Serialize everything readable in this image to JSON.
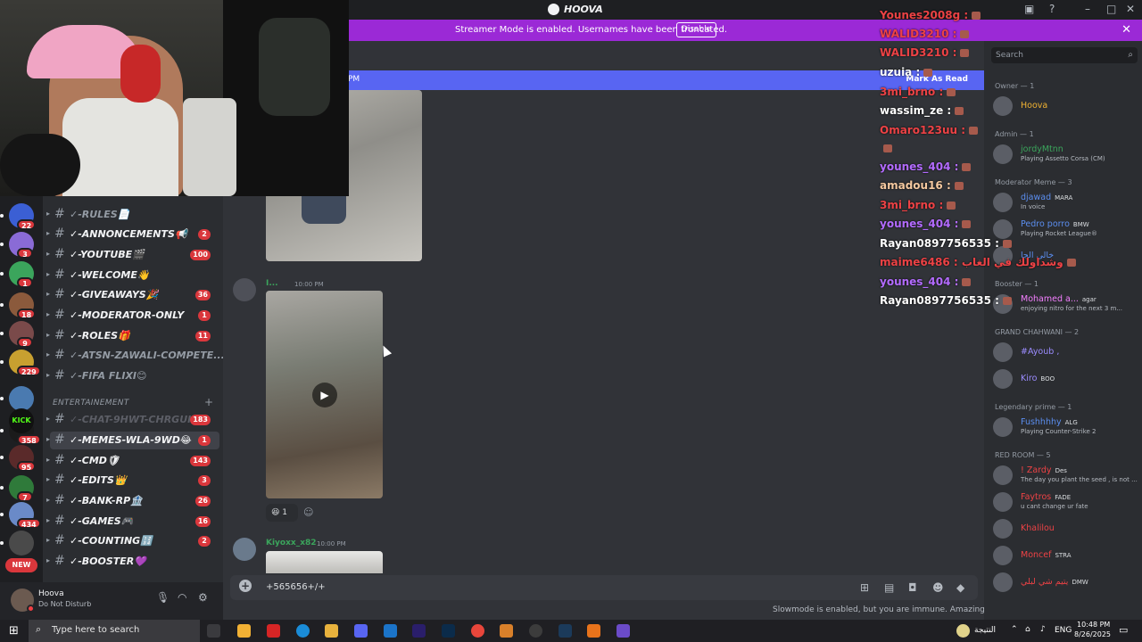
{
  "titlebar": {
    "brand": "HOOVA"
  },
  "banner": {
    "text": "Streamer Mode is enabled. Usernames have been truncated.",
    "button": "Disable"
  },
  "rail": {
    "badges": [
      "22",
      "3",
      "1",
      "18",
      "9",
      "229",
      "358",
      "95",
      "7",
      "434"
    ],
    "new_label": "NEW",
    "kick_label": "KICK"
  },
  "channels": {
    "items": [
      {
        "name": "✓-RULES📄",
        "count": "",
        "state": "dim"
      },
      {
        "name": "✓-ANNONCEMENTS📢",
        "count": "2",
        "state": "normal"
      },
      {
        "name": "✓-YOUTUBE🎬",
        "count": "100",
        "state": "normal"
      },
      {
        "name": "✓-WELCOME👋",
        "count": "",
        "state": "normal"
      },
      {
        "name": "✓-GIVEAWAYS🎉",
        "count": "36",
        "state": "normal"
      },
      {
        "name": "✓-MODERATOR-ONLY",
        "count": "1",
        "state": "normal"
      },
      {
        "name": "✓-ROLES🎁",
        "count": "11",
        "state": "normal"
      },
      {
        "name": "✓-ATSN-ZAWALI-COMPETE...",
        "count": "",
        "state": "dim"
      },
      {
        "name": "✓-FIFA FLIXI😊",
        "count": "",
        "state": "dim"
      }
    ],
    "category": "ENTERTAINEMENT",
    "items2": [
      {
        "name": "✓-CHAT-9HWT-CHRGUI",
        "count": "183",
        "state": "muted"
      },
      {
        "name": "✓-MEMES-WLA-9WD😂",
        "count": "1",
        "state": "active"
      },
      {
        "name": "✓-CMD🛡",
        "count": "143",
        "state": "normal"
      },
      {
        "name": "✓-EDITS👑",
        "count": "3",
        "state": "normal"
      },
      {
        "name": "✓-BANK-RP🏦",
        "count": "26",
        "state": "normal"
      },
      {
        "name": "✓-GAMES🎮",
        "count": "16",
        "state": "normal"
      },
      {
        "name": "✓-COUNTING🔢",
        "count": "2",
        "state": "normal"
      },
      {
        "name": "✓-BOOSTER💜",
        "count": "",
        "state": "normal"
      }
    ]
  },
  "user": {
    "name": "Hoova",
    "status": "Do Not Disturb"
  },
  "chat": {
    "mark_read_left": "PM",
    "mark_read": "Mark As Read",
    "msg1_name": "I...",
    "msg1_time": "10:00 PM",
    "reaction_count": "1",
    "msg2_name": "Kiyoxx_x82",
    "msg2_time": "10:00 PM"
  },
  "composer": {
    "text": "+565656+/+",
    "slowmode": "Slowmode is enabled, but you are immune. Amazing!"
  },
  "members": {
    "search_placeholder": "Search",
    "groups": [
      {
        "title": "Owner — 1",
        "list": [
          {
            "name": "Hoova",
            "sub": "",
            "tag": "",
            "color": "#f0b232"
          }
        ]
      },
      {
        "title": "Admin — 1",
        "list": [
          {
            "name": "jordyMtnn",
            "sub": "Playing Assetto Corsa (CM)",
            "tag": "",
            "color": "#3ba55c"
          }
        ]
      },
      {
        "title": "Moderator Meme — 3",
        "list": [
          {
            "name": "djawad",
            "sub": "In voice",
            "tag": "MARA",
            "color": "#5b8ef0"
          },
          {
            "name": "Pedro porro",
            "sub": "Playing Rocket League®",
            "tag": "BMW",
            "color": "#5b8ef0"
          },
          {
            "name": "خالي الجا",
            "sub": "",
            "tag": "",
            "color": "#5b8ef0"
          }
        ]
      },
      {
        "title": "Booster — 1",
        "list": [
          {
            "name": "Mohamed a...",
            "sub": "enjoying nitro for the next 3 m...",
            "tag": "agar",
            "color": "#f47fff"
          }
        ]
      },
      {
        "title": "GRAND CHAHWANI — 2",
        "list": [
          {
            "name": "#Ayoub ,",
            "sub": "",
            "tag": "",
            "color": "#9b8cff"
          },
          {
            "name": "Kiro",
            "sub": "",
            "tag": "BOO",
            "color": "#9b8cff"
          }
        ]
      },
      {
        "title": "Legendary prime — 1",
        "list": [
          {
            "name": "Fushhhhy",
            "sub": "Playing Counter-Strike 2",
            "tag": "ALG",
            "color": "#5b8ef0"
          }
        ]
      },
      {
        "title": "RED ROOM — 5",
        "list": [
          {
            "name": "! Zardy",
            "sub": "The day you plant the seed , is not ...",
            "tag": "Des",
            "color": "#ed4245"
          },
          {
            "name": "Faytros",
            "sub": "u cant change ur fate",
            "tag": "FADE",
            "color": "#ed4245"
          },
          {
            "name": "Khalilou",
            "sub": "",
            "tag": "",
            "color": "#ed4245"
          },
          {
            "name": "Moncef",
            "sub": "",
            "tag": "STRA",
            "color": "#ed4245"
          },
          {
            "name": "يتيم شي لبلي",
            "sub": "",
            "tag": "DMW",
            "color": "#ed4245"
          }
        ]
      }
    ]
  },
  "overlay_chat": [
    {
      "text": "Younes2008g :",
      "color": "#ed4245"
    },
    {
      "text": "WALID3210 :",
      "color": "#ed4245"
    },
    {
      "text": "WALID3210 :",
      "color": "#ed4245"
    },
    {
      "text": "uzuia :",
      "color": "#ffffff"
    },
    {
      "text": "3mi_brno :",
      "color": "#ed4245"
    },
    {
      "text": "wassim_ze :",
      "color": "#ffffff"
    },
    {
      "text": "Omaro123uu :",
      "color": "#ed4245"
    },
    {
      "text": "",
      "color": "#ed4245"
    },
    {
      "text": "younes_404 :",
      "color": "#b36bff"
    },
    {
      "text": "amadou16 :",
      "color": "#f5c9a0"
    },
    {
      "text": "3mi_brno :",
      "color": "#ed4245"
    },
    {
      "text": "younes_404 :",
      "color": "#b36bff"
    },
    {
      "text": "Rayan0897756535 :",
      "color": "#ffffff"
    },
    {
      "text": "maime6486 : وشداولك في الغاب",
      "color": "#ed4245"
    },
    {
      "text": "younes_404 :",
      "color": "#b36bff"
    },
    {
      "text": "Rayan0897756535 :",
      "color": "#ffffff"
    }
  ],
  "taskbar": {
    "search_placeholder": "Type here to search",
    "weather": "النتيجة",
    "lang": "ENG",
    "time": "10:48 PM",
    "date": "8/26/2025"
  }
}
